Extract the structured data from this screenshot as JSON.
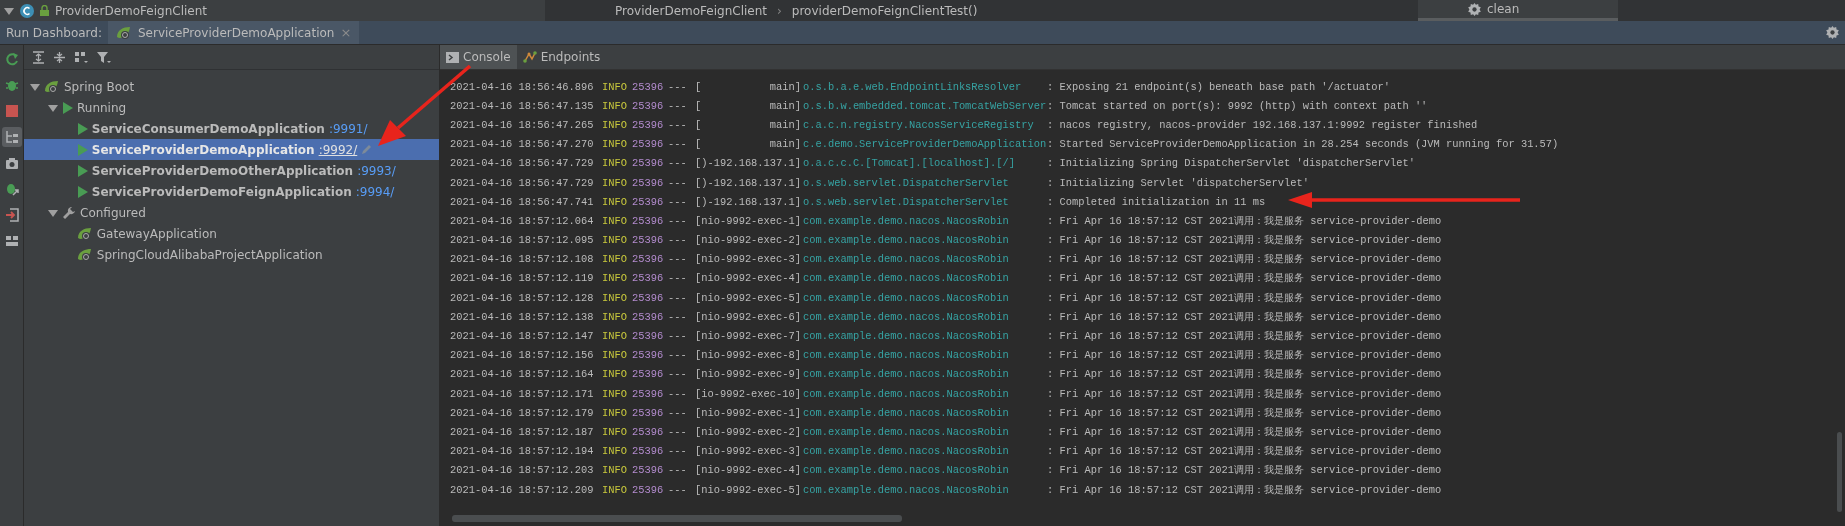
{
  "title_bar": {
    "project": "ProviderDemoFeignClient",
    "breadcrumb": [
      {
        "label": "ProviderDemoFeignClient"
      },
      {
        "label": "providerDemoFeignClientTest()"
      }
    ],
    "separator": "›",
    "popup_item": "clean"
  },
  "run_dashboard": {
    "label": "Run Dashboard:",
    "tab": {
      "label": "ServiceProviderDemoApplication",
      "close": "×"
    }
  },
  "side_tools": [
    {
      "kind": "rerun",
      "selected": false
    },
    {
      "kind": "debug",
      "selected": false
    },
    {
      "kind": "stop",
      "selected": false
    },
    {
      "kind": "tree",
      "selected": true
    },
    {
      "kind": "camera",
      "selected": false
    },
    {
      "kind": "attach",
      "selected": false
    },
    {
      "kind": "exit",
      "selected": false
    },
    {
      "kind": "layout",
      "selected": false
    }
  ],
  "tree": [
    {
      "label": "Spring Boot",
      "kind": "spring",
      "expanded": true,
      "children": [
        {
          "label": "Running",
          "kind": "running",
          "expanded": true,
          "children": [
            {
              "label": "ServiceConsumerDemoApplication",
              "port": ":9991/",
              "selected": false
            },
            {
              "label": "ServiceProviderDemoApplication",
              "port": ":9992/",
              "selected": true
            },
            {
              "label": "ServiceProviderDemoOtherApplication",
              "port": ":9993/",
              "selected": false
            },
            {
              "label": "ServiceProviderDemoFeignApplication",
              "port": ":9994/",
              "selected": false
            }
          ]
        },
        {
          "label": "Configured",
          "kind": "configured",
          "expanded": true,
          "children": [
            {
              "label": "GatewayApplication",
              "selected": false
            },
            {
              "label": "SpringCloudAlibabaProjectApplication",
              "selected": false
            }
          ]
        }
      ]
    }
  ],
  "console_tabs": [
    {
      "label": "Console",
      "kind": "console",
      "selected": true
    },
    {
      "label": "Endpoints",
      "kind": "endpoints",
      "selected": false
    }
  ],
  "log": [
    {
      "time": "2021-04-16 18:56:46.896",
      "level": "INFO",
      "pid": "25396",
      "dash": "---",
      "thread": "[           main]",
      "logger": "o.s.b.a.e.web.EndpointLinksResolver",
      "message": ": Exposing 21 endpoint(s) beneath base path '/actuator'"
    },
    {
      "time": "2021-04-16 18:56:47.135",
      "level": "INFO",
      "pid": "25396",
      "dash": "---",
      "thread": "[           main]",
      "logger": "o.s.b.w.embedded.tomcat.TomcatWebServer",
      "message": ": Tomcat started on port(s): 9992 (http) with context path ''"
    },
    {
      "time": "2021-04-16 18:56:47.265",
      "level": "INFO",
      "pid": "25396",
      "dash": "---",
      "thread": "[           main]",
      "logger": "c.a.c.n.registry.NacosServiceRegistry",
      "message": ": nacos registry, nacos-provider 192.168.137.1:9992 register finished"
    },
    {
      "time": "2021-04-16 18:56:47.270",
      "level": "INFO",
      "pid": "25396",
      "dash": "---",
      "thread": "[           main]",
      "logger": "c.e.demo.ServiceProviderDemoApplication",
      "message": ": Started ServiceProviderDemoApplication in 28.254 seconds (JVM running for 31.57)"
    },
    {
      "time": "2021-04-16 18:56:47.729",
      "level": "INFO",
      "pid": "25396",
      "dash": "---",
      "thread": "[)-192.168.137.1]",
      "logger": "o.a.c.c.C.[Tomcat].[localhost].[/]",
      "message": ": Initializing Spring DispatcherServlet 'dispatcherServlet'"
    },
    {
      "time": "2021-04-16 18:56:47.729",
      "level": "INFO",
      "pid": "25396",
      "dash": "---",
      "thread": "[)-192.168.137.1]",
      "logger": "o.s.web.servlet.DispatcherServlet",
      "message": ": Initializing Servlet 'dispatcherServlet'"
    },
    {
      "time": "2021-04-16 18:56:47.741",
      "level": "INFO",
      "pid": "25396",
      "dash": "---",
      "thread": "[)-192.168.137.1]",
      "logger": "o.s.web.servlet.DispatcherServlet",
      "message": ": Completed initialization in 11 ms"
    },
    {
      "time": "2021-04-16 18:57:12.064",
      "level": "INFO",
      "pid": "25396",
      "dash": "---",
      "thread": "[nio-9992-exec-1]",
      "logger": "com.example.demo.nacos.NacosRobin",
      "message": ": Fri Apr 16 18:57:12 CST 2021调用：我是服务 service-provider-demo"
    },
    {
      "time": "2021-04-16 18:57:12.095",
      "level": "INFO",
      "pid": "25396",
      "dash": "---",
      "thread": "[nio-9992-exec-2]",
      "logger": "com.example.demo.nacos.NacosRobin",
      "message": ": Fri Apr 16 18:57:12 CST 2021调用：我是服务 service-provider-demo"
    },
    {
      "time": "2021-04-16 18:57:12.108",
      "level": "INFO",
      "pid": "25396",
      "dash": "---",
      "thread": "[nio-9992-exec-3]",
      "logger": "com.example.demo.nacos.NacosRobin",
      "message": ": Fri Apr 16 18:57:12 CST 2021调用：我是服务 service-provider-demo"
    },
    {
      "time": "2021-04-16 18:57:12.119",
      "level": "INFO",
      "pid": "25396",
      "dash": "---",
      "thread": "[nio-9992-exec-4]",
      "logger": "com.example.demo.nacos.NacosRobin",
      "message": ": Fri Apr 16 18:57:12 CST 2021调用：我是服务 service-provider-demo"
    },
    {
      "time": "2021-04-16 18:57:12.128",
      "level": "INFO",
      "pid": "25396",
      "dash": "---",
      "thread": "[nio-9992-exec-5]",
      "logger": "com.example.demo.nacos.NacosRobin",
      "message": ": Fri Apr 16 18:57:12 CST 2021调用：我是服务 service-provider-demo"
    },
    {
      "time": "2021-04-16 18:57:12.138",
      "level": "INFO",
      "pid": "25396",
      "dash": "---",
      "thread": "[nio-9992-exec-6]",
      "logger": "com.example.demo.nacos.NacosRobin",
      "message": ": Fri Apr 16 18:57:12 CST 2021调用：我是服务 service-provider-demo"
    },
    {
      "time": "2021-04-16 18:57:12.147",
      "level": "INFO",
      "pid": "25396",
      "dash": "---",
      "thread": "[nio-9992-exec-7]",
      "logger": "com.example.demo.nacos.NacosRobin",
      "message": ": Fri Apr 16 18:57:12 CST 2021调用：我是服务 service-provider-demo"
    },
    {
      "time": "2021-04-16 18:57:12.156",
      "level": "INFO",
      "pid": "25396",
      "dash": "---",
      "thread": "[nio-9992-exec-8]",
      "logger": "com.example.demo.nacos.NacosRobin",
      "message": ": Fri Apr 16 18:57:12 CST 2021调用：我是服务 service-provider-demo"
    },
    {
      "time": "2021-04-16 18:57:12.164",
      "level": "INFO",
      "pid": "25396",
      "dash": "---",
      "thread": "[nio-9992-exec-9]",
      "logger": "com.example.demo.nacos.NacosRobin",
      "message": ": Fri Apr 16 18:57:12 CST 2021调用：我是服务 service-provider-demo"
    },
    {
      "time": "2021-04-16 18:57:12.171",
      "level": "INFO",
      "pid": "25396",
      "dash": "---",
      "thread": "[io-9992-exec-10]",
      "logger": "com.example.demo.nacos.NacosRobin",
      "message": ": Fri Apr 16 18:57:12 CST 2021调用：我是服务 service-provider-demo"
    },
    {
      "time": "2021-04-16 18:57:12.179",
      "level": "INFO",
      "pid": "25396",
      "dash": "---",
      "thread": "[nio-9992-exec-1]",
      "logger": "com.example.demo.nacos.NacosRobin",
      "message": ": Fri Apr 16 18:57:12 CST 2021调用：我是服务 service-provider-demo"
    },
    {
      "time": "2021-04-16 18:57:12.187",
      "level": "INFO",
      "pid": "25396",
      "dash": "---",
      "thread": "[nio-9992-exec-2]",
      "logger": "com.example.demo.nacos.NacosRobin",
      "message": ": Fri Apr 16 18:57:12 CST 2021调用：我是服务 service-provider-demo"
    },
    {
      "time": "2021-04-16 18:57:12.194",
      "level": "INFO",
      "pid": "25396",
      "dash": "---",
      "thread": "[nio-9992-exec-3]",
      "logger": "com.example.demo.nacos.NacosRobin",
      "message": ": Fri Apr 16 18:57:12 CST 2021调用：我是服务 service-provider-demo"
    },
    {
      "time": "2021-04-16 18:57:12.203",
      "level": "INFO",
      "pid": "25396",
      "dash": "---",
      "thread": "[nio-9992-exec-4]",
      "logger": "com.example.demo.nacos.NacosRobin",
      "message": ": Fri Apr 16 18:57:12 CST 2021调用：我是服务 service-provider-demo"
    },
    {
      "time": "2021-04-16 18:57:12.209",
      "level": "INFO",
      "pid": "25396",
      "dash": "---",
      "thread": "[nio-9992-exec-5]",
      "logger": "com.example.demo.nacos.NacosRobin",
      "message": ": Fri Apr 16 18:57:12 CST 2021调用：我是服务 service-provider-demo"
    }
  ]
}
